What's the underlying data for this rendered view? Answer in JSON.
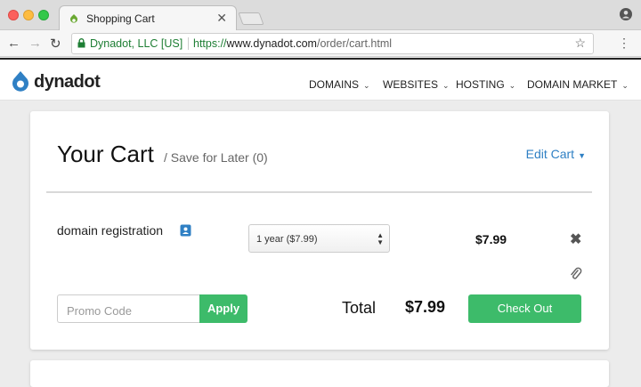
{
  "browser": {
    "tab_title": "Shopping Cart",
    "tab_close": "✕",
    "secure_label": "Dynadot, LLC [US]",
    "url_scheme": "https://",
    "url_domain": "www.dynadot.com",
    "url_path": "/order/cart.html",
    "back_icon": "←",
    "forward_icon": "→",
    "reload_icon": "↻",
    "star_icon": "☆",
    "menu_icon": "⋮"
  },
  "site": {
    "logo_text": "dynadot",
    "brand_color": "#2f80c4",
    "nav": [
      {
        "label": "DOMAINS"
      },
      {
        "label": "WEBSITES"
      },
      {
        "label": "HOSTING"
      },
      {
        "label": "DOMAIN MARKET"
      }
    ],
    "chevron": "⌄"
  },
  "cart": {
    "title": "Your Cart",
    "save_for_later": "/ Save for Later (0)",
    "edit_cart": "Edit Cart",
    "edit_caret": "▼",
    "item": {
      "name": "domain registration",
      "period_selected": "1 year ($7.99)",
      "price": "$7.99",
      "remove_icon": "✖"
    },
    "promo_placeholder": "Promo Code",
    "apply_label": "Apply",
    "total_label": "Total",
    "total_value": "$7.99",
    "checkout_label": "Check Out",
    "accent_green": "#3dbb6a"
  }
}
